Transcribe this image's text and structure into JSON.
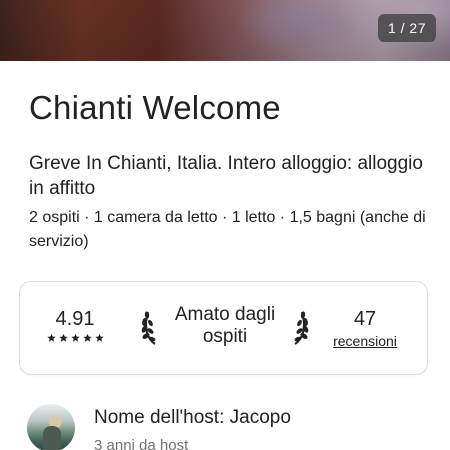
{
  "photo": {
    "counter": "1 / 27"
  },
  "listing": {
    "title": "Chianti Welcome",
    "subtitle": "Greve In Chianti, Italia. Intero alloggio: alloggio in affitto",
    "details": "2 ospiti · 1 camera da letto · 1 letto · 1,5 bagni (anche di servizio)"
  },
  "highlights": {
    "rating": "4.91",
    "stars": 5,
    "favorite_label": "Amato dagli ospiti",
    "reviews_count": "47",
    "reviews_label": "recensioni"
  },
  "host": {
    "name_label": "Nome dell'host: Jacopo",
    "since": "3 anni da host"
  },
  "colors": {
    "text": "#222222",
    "muted": "#717171",
    "border": "#dddddd"
  }
}
